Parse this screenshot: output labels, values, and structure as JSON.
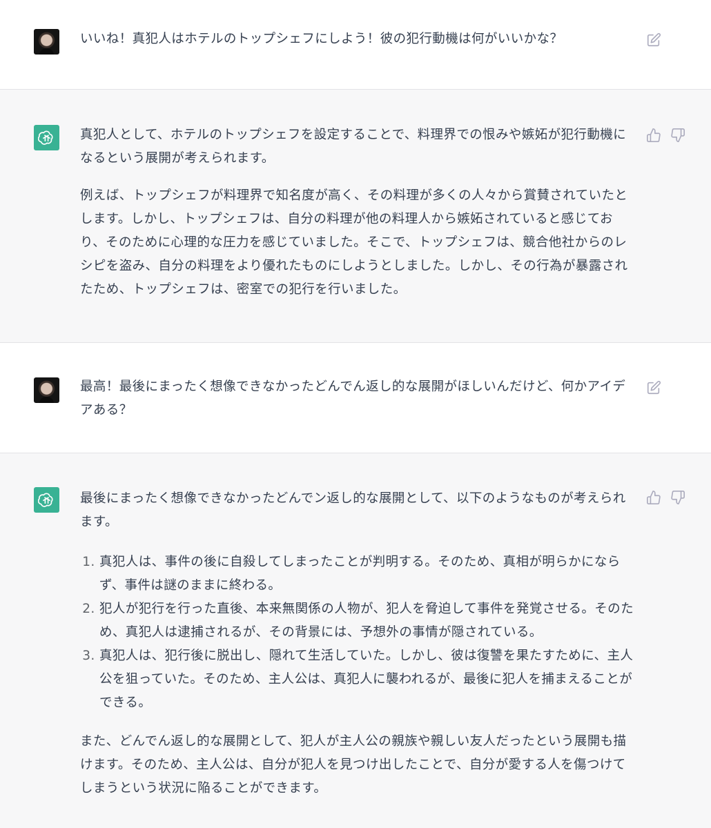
{
  "messages": [
    {
      "role": "user",
      "text": "いいね！真犯人はホテルのトップシェフにしよう！彼の犯行動機は何がいいかな？"
    },
    {
      "role": "assistant",
      "paragraphs": [
        "真犯人として、ホテルのトップシェフを設定することで、料理界での恨みや嫉妬が犯行動機になるという展開が考えられます。",
        "例えば、トップシェフが料理界で知名度が高く、その料理が多くの人々から賞賛されていたとします。しかし、トップシェフは、自分の料理が他の料理人から嫉妬されていると感じており、そのために心理的な圧力を感じていました。そこで、トップシェフは、競合他社からのレシピを盗み、自分の料理をより優れたものにしようとしました。しかし、その行為が暴露されたため、トップシェフは、密室での犯行を行いました。"
      ]
    },
    {
      "role": "user",
      "text": "最高！最後にまったく想像できなかったどんでん返し的な展開がほしいんだけど、何かアイデアある？"
    },
    {
      "role": "assistant",
      "intro": "最後にまったく想像できなかったどんでン返し的な展開として、以下のようなものが考えられます。",
      "list": [
        "真犯人は、事件の後に自殺してしまったことが判明する。そのため、真相が明らかにならず、事件は謎のままに終わる。",
        "犯人が犯行を行った直後、本来無関係の人物が、犯人を脅迫して事件を発覚させる。そのため、真犯人は逮捕されるが、その背景には、予想外の事情が隠されている。",
        "真犯人は、犯行後に脱出し、隠れて生活していた。しかし、彼は復讐を果たすために、主人公を狙っていた。そのため、主人公は、真犯人に襲われるが、最後に犯人を捕まえることができる。"
      ],
      "outro": "また、どんでん返し的な展開として、犯人が主人公の親族や親しい友人だったという展開も描けます。そのため、主人公は、自分が犯人を見つけ出したことで、自分が愛する人を傷つけてしまうという状況に陥ることができます。"
    }
  ],
  "icons": {
    "edit": "edit-icon",
    "thumbs_up": "thumbs-up-icon",
    "thumbs_down": "thumbs-down-icon",
    "assistant_avatar": "openai-logo-icon"
  },
  "colors": {
    "assistant_bg": "#f7f7f8",
    "user_bg": "#ffffff",
    "text": "#374151",
    "brand": "#10a37f",
    "icon": "#acacbe"
  }
}
